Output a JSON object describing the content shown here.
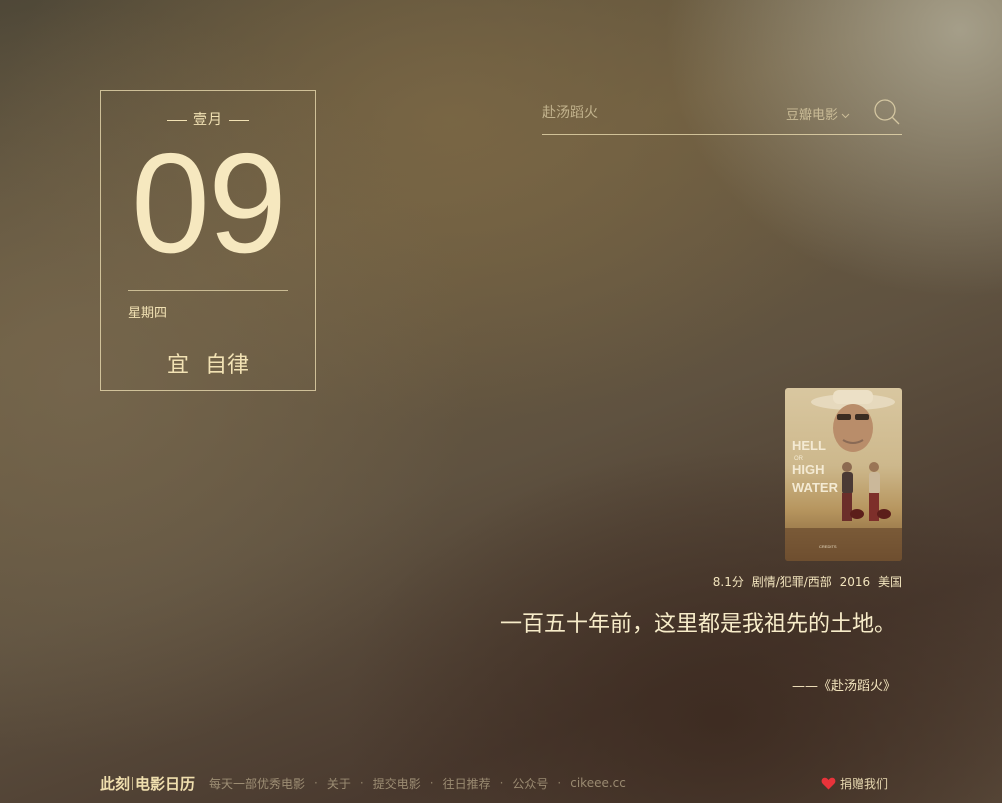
{
  "calendar": {
    "month": "壹月",
    "day": "09",
    "weekday": "星期四",
    "yi_label": "宜",
    "yi_value": "自律"
  },
  "search": {
    "placeholder": "赴汤蹈火",
    "source": "豆瓣电影",
    "source_chevron": "chevron-down-icon",
    "button_icon": "search-icon"
  },
  "movie": {
    "poster_icon": "movie-poster",
    "rating": "8.1分",
    "genres": "剧情/犯罪/西部",
    "year": "2016",
    "country": "美国",
    "quote": "一百五十年前，这里都是我祖先的土地。",
    "source": "——《赴汤蹈火》"
  },
  "footer": {
    "brand_left": "此刻",
    "brand_right": "电影日历",
    "links": [
      "每天一部优秀电影",
      "关于",
      "提交电影",
      "往日推荐",
      "公众号",
      "cikeee.cc"
    ],
    "separator": "·",
    "donate_label": "捐赠我们",
    "donate_icon": "heart-icon"
  },
  "colors": {
    "accent_text": "#f2e2b4",
    "heart": "#e8333a"
  }
}
